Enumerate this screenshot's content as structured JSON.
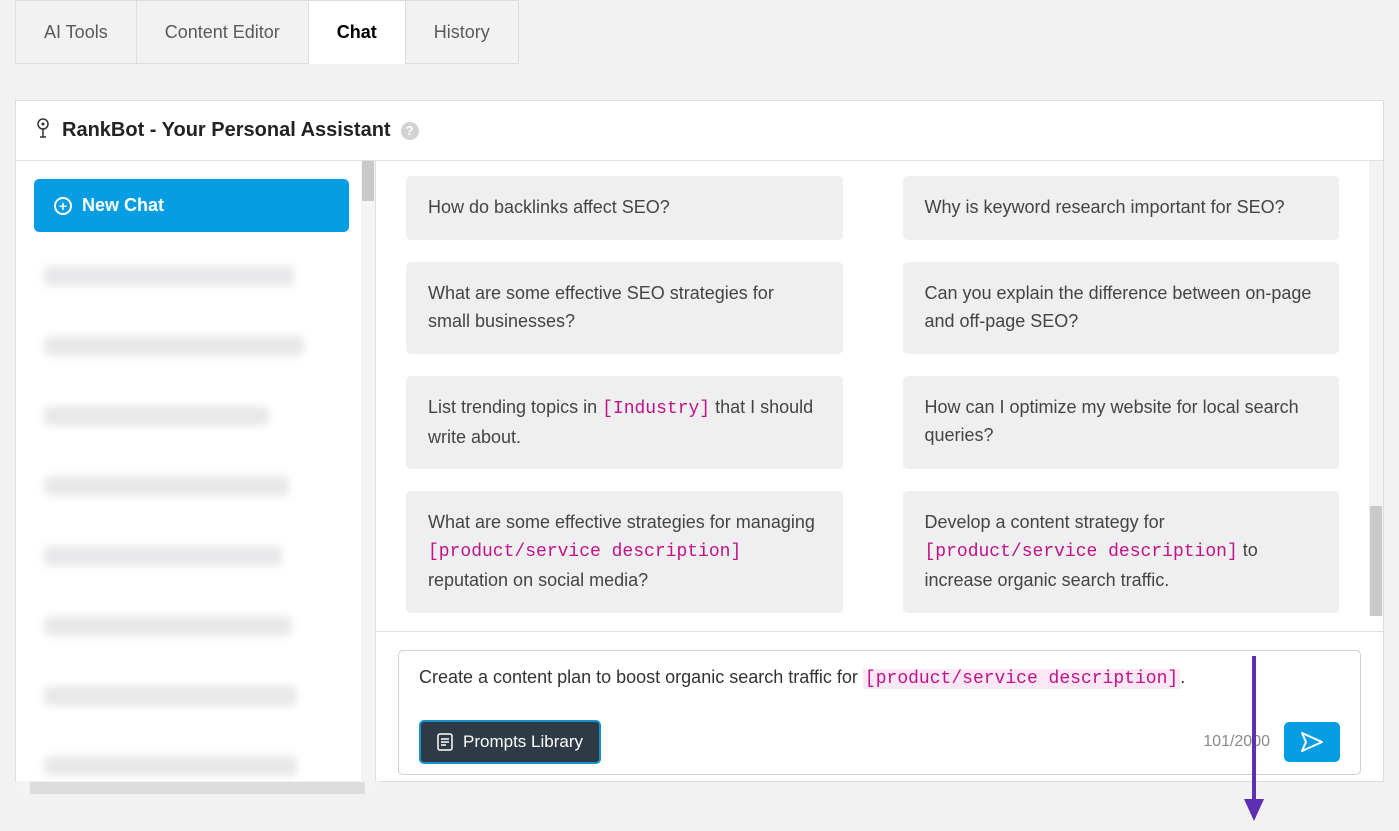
{
  "tabs": [
    "AI Tools",
    "Content Editor",
    "Chat",
    "History"
  ],
  "active_tab_index": 2,
  "panel_title": "RankBot - Your Personal Assistant",
  "sidebar": {
    "new_chat_label": "New Chat"
  },
  "suggestions": [
    {
      "segments": [
        {
          "t": "How do backlinks affect SEO?",
          "ph": false
        }
      ]
    },
    {
      "segments": [
        {
          "t": "Why is keyword research important for SEO?",
          "ph": false
        }
      ]
    },
    {
      "segments": [
        {
          "t": "What are some effective SEO strategies for small businesses?",
          "ph": false
        }
      ]
    },
    {
      "segments": [
        {
          "t": "Can you explain the difference between on-page and off-page SEO?",
          "ph": false
        }
      ]
    },
    {
      "segments": [
        {
          "t": "List trending topics in ",
          "ph": false
        },
        {
          "t": "[Industry]",
          "ph": true
        },
        {
          "t": " that I should write about.",
          "ph": false
        }
      ]
    },
    {
      "segments": [
        {
          "t": "How can I optimize my website for local search queries?",
          "ph": false
        }
      ]
    },
    {
      "segments": [
        {
          "t": "What are some effective strategies for managing ",
          "ph": false
        },
        {
          "t": "[product/service description]",
          "ph": true
        },
        {
          "t": " reputation on social media?",
          "ph": false
        }
      ]
    },
    {
      "segments": [
        {
          "t": "Develop a content strategy for ",
          "ph": false
        },
        {
          "t": "[product/service description]",
          "ph": true
        },
        {
          "t": " to increase organic search traffic.",
          "ph": false
        }
      ]
    }
  ],
  "input": {
    "segments": [
      {
        "t": "Create a content plan to boost organic search traffic for ",
        "ph": false
      },
      {
        "t": "[product/service description]",
        "ph": true
      },
      {
        "t": ".",
        "ph": false
      }
    ],
    "prompts_library_label": "Prompts Library",
    "char_count": "101/2000"
  }
}
